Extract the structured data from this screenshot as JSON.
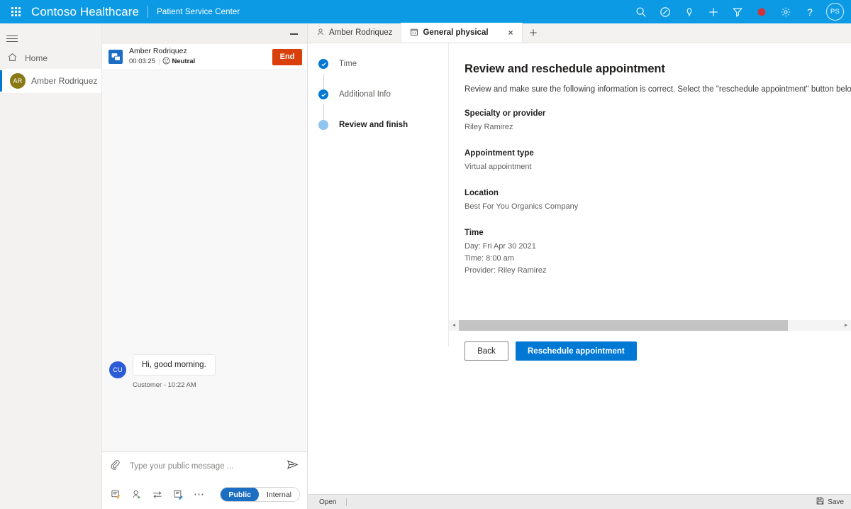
{
  "topbar": {
    "waffle_label": "app-launcher",
    "brand": "Contoso Healthcare",
    "app_name": "Patient Service Center",
    "background": "#0d9ae5",
    "icons": [
      {
        "name": "search-icon",
        "label": "Search"
      },
      {
        "name": "assistant-icon",
        "label": "Assistant"
      },
      {
        "name": "lightbulb-icon",
        "label": "Insights"
      },
      {
        "name": "plus-icon",
        "label": "New"
      },
      {
        "name": "filter-icon",
        "label": "Filter"
      },
      {
        "name": "record-icon",
        "label": "Record"
      },
      {
        "name": "gear-icon",
        "label": "Settings"
      },
      {
        "name": "help-icon",
        "label": "Help"
      }
    ],
    "user_initials": "PS"
  },
  "sidebar": {
    "items": [
      {
        "label": "Home",
        "icon": "home-icon",
        "selected": false
      },
      {
        "label": "Amber Rodriquez",
        "icon": "avatar",
        "initials": "AR",
        "selected": true
      }
    ]
  },
  "conversation": {
    "minimize_label": "Minimize",
    "customer_name": "Amber Rodriquez",
    "duration": "00:03:25",
    "sentiment": "Neutral",
    "end_label": "End",
    "messages": [
      {
        "initials": "CU",
        "text": "Hi, good morning.",
        "caption": "Customer - 10:22 AM"
      }
    ],
    "composer": {
      "placeholder": "Type your public message ...",
      "value": "",
      "attach_icon": "paperclip-icon",
      "send_icon": "send-icon",
      "tools": [
        {
          "name": "quick-reply-icon",
          "label": "Quick replies"
        },
        {
          "name": "add-participant-icon",
          "label": "Add participant"
        },
        {
          "name": "transfer-icon",
          "label": "Transfer"
        },
        {
          "name": "note-icon",
          "label": "Notes"
        },
        {
          "name": "more-icon",
          "label": "More"
        }
      ],
      "toggle": {
        "public": "Public",
        "internal": "Internal",
        "active": "Public"
      }
    }
  },
  "tabs": {
    "items": [
      {
        "label": "Amber Rodriquez",
        "icon": "person-icon",
        "active": false,
        "closable": false
      },
      {
        "label": "General physical",
        "icon": "calendar-icon",
        "active": true,
        "closable": true
      }
    ],
    "close_glyph": "×",
    "add_label": "+"
  },
  "stepper": {
    "steps": [
      {
        "label": "Time",
        "state": "done"
      },
      {
        "label": "Additional Info",
        "state": "done"
      },
      {
        "label": "Review and finish",
        "state": "current"
      }
    ]
  },
  "form": {
    "title": "Review and reschedule appointment",
    "description": "Review and make sure the following information is correct. Select the \"reschedule appointment\" button below to update the appointment.",
    "fields": [
      {
        "label": "Specialty or provider",
        "value": "Riley Ramirez"
      },
      {
        "label": "Appointment type",
        "value": "Virtual appointment"
      },
      {
        "label": "Location",
        "value": "Best For You Organics Company"
      },
      {
        "label": "Time",
        "value": "Day: Fri Apr 30 2021\nTime: 8:00 am\nProvider: Riley Ramirez"
      }
    ],
    "buttons": {
      "back": "Back",
      "primary": "Reschedule appointment"
    },
    "accent": "#0078d4"
  },
  "statusbar": {
    "state": "Open",
    "save_label": "Save",
    "save_icon": "save-icon"
  }
}
